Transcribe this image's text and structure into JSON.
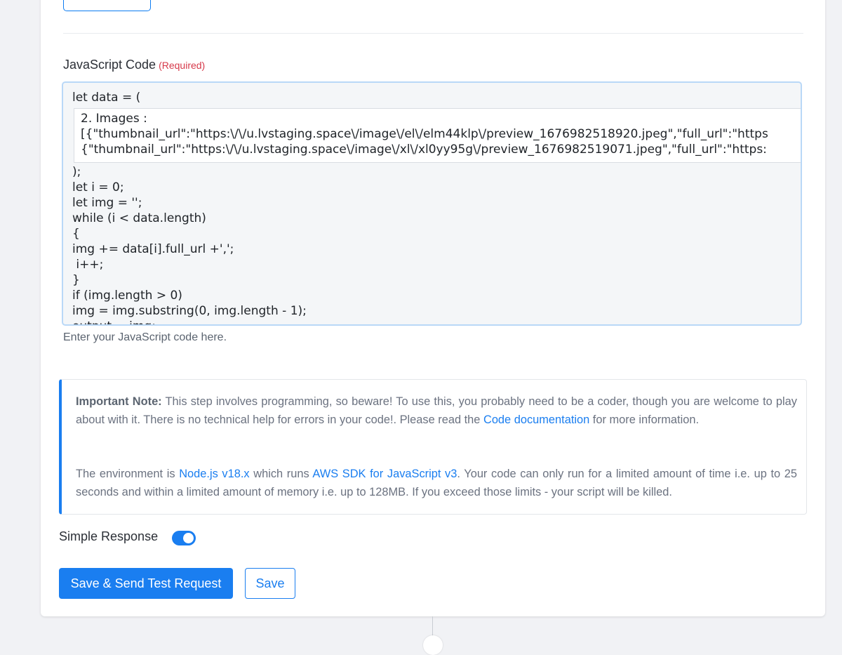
{
  "field": {
    "label": "JavaScript Code",
    "required": "(Required)",
    "hint": "Enter your JavaScript code here."
  },
  "code": {
    "line1": "let data = (",
    "embedded": [
      "2. Images :",
      "[{\"thumbnail_url\":\"https:\\/\\/u.lvstaging.space\\/image\\/el\\/elm44klp\\/preview_1676982518920.jpeg\",\"full_url\":\"https",
      "{\"thumbnail_url\":\"https:\\/\\/u.lvstaging.space\\/image\\/xl\\/xl0yy95g\\/preview_1676982519071.jpeg\",\"full_url\":\"https:"
    ],
    "lines": [
      ");",
      "let i = 0;",
      "let img = '';",
      "while (i < data.length)",
      "{",
      "img += data[i].full_url +',';",
      " i++;",
      "}",
      "if (img.length > 0)",
      "img = img.substring(0, img.length - 1);",
      "output = img;"
    ]
  },
  "note": {
    "strong": "Important Note:",
    "text1": " This step involves programming, so beware! To use this, you probably need to be a coder, though you are welcome to play about with it. There is no technical help for errors in your code!. Please read the ",
    "link1": "Code documentation",
    "text2": " for more information.",
    "text3": "The environment is ",
    "link2": "Node.js v18.x",
    "text4": " which runs ",
    "link3": "AWS SDK for JavaScript v3",
    "text5": ". Your code can only run for a limited amount of time i.e. up to 25 seconds and within a limited amount of memory i.e. up to 128MB. If you exceed those limits - your script will be killed."
  },
  "toggle": {
    "label": "Simple Response",
    "state": "on"
  },
  "buttons": {
    "primary": "Save & Send Test Request",
    "secondary": "Save"
  },
  "colors": {
    "accent": "#1a7ef0",
    "required": "#d6394a"
  }
}
